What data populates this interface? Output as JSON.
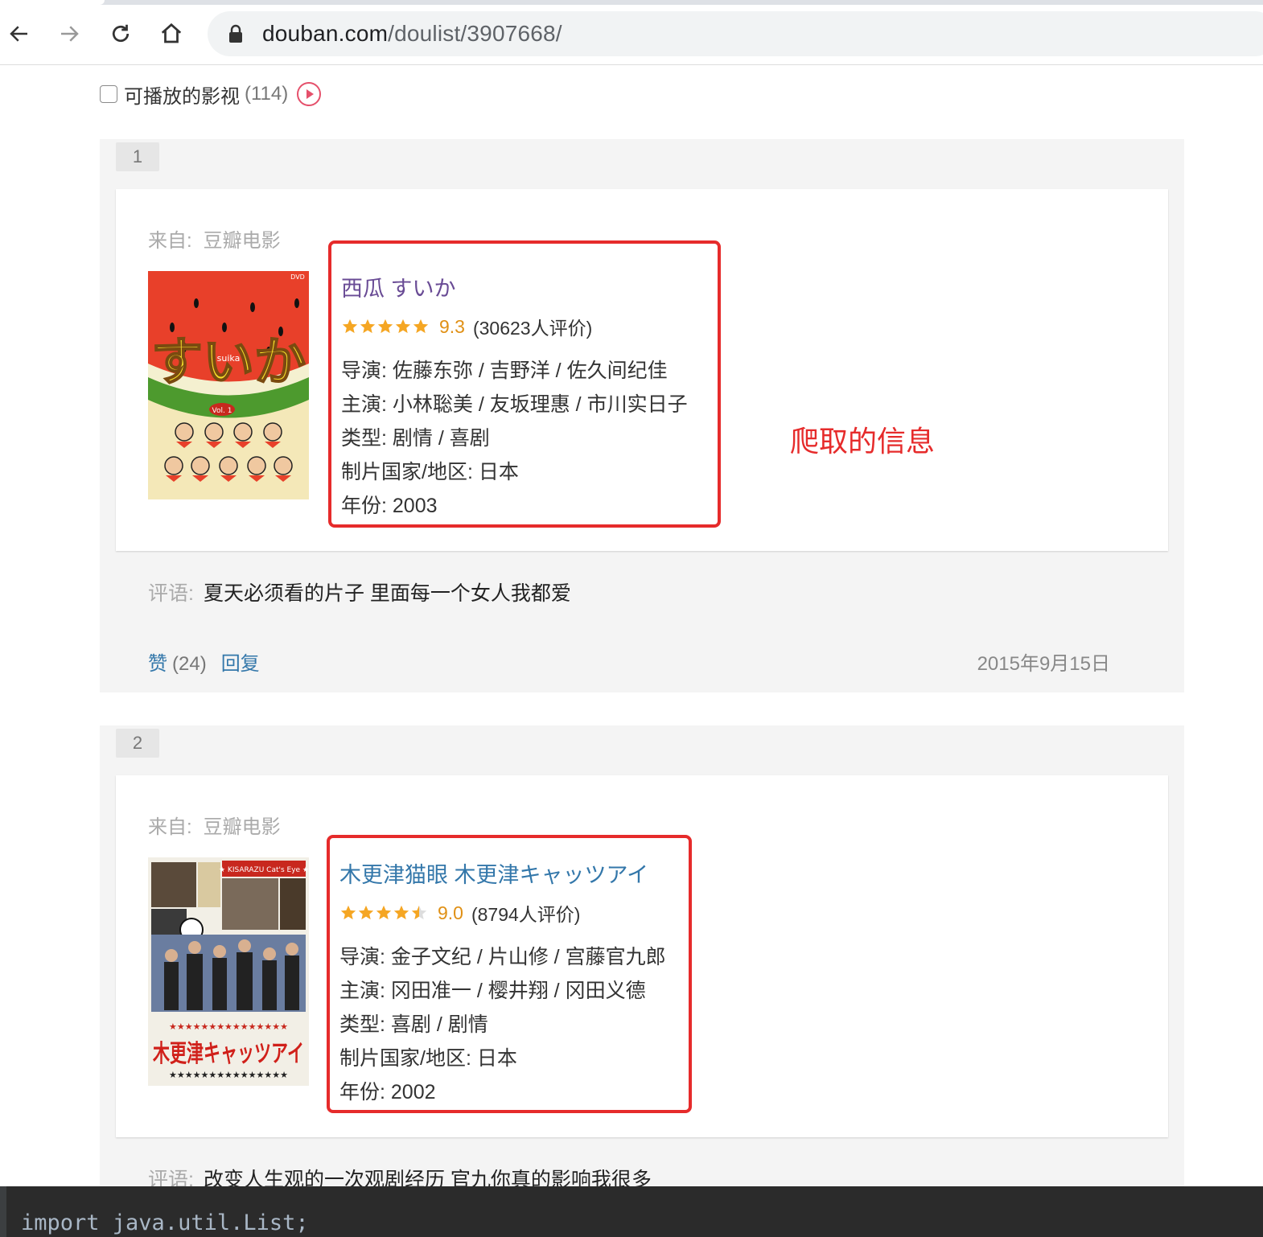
{
  "browser": {
    "url_host": "douban.com",
    "url_path": "/doulist/3907668/"
  },
  "filter": {
    "label": "可播放的影视",
    "count": "(114)"
  },
  "annotation": "爬取的信息",
  "items": [
    {
      "index": "1",
      "source_label": "来自:",
      "source": "豆瓣电影",
      "title": "西瓜 すいか",
      "stars": 5,
      "score": "9.3",
      "votes": "(30623人评价)",
      "director": "导演: 佐藤东弥 / 吉野洋 / 佐久间纪佳",
      "cast": "主演: 小林聡美 / 友坂理惠 / 市川实日子",
      "genre": "类型: 剧情 / 喜剧",
      "country": "制片国家/地区: 日本",
      "year": "年份: 2003",
      "comment_label": "评语:",
      "comment": "夏天必须看的片子 里面每一个女人我都爱",
      "like_label": "赞",
      "like_count": "(24)",
      "reply_label": "回复",
      "date": "2015年9月15日"
    },
    {
      "index": "2",
      "source_label": "来自:",
      "source": "豆瓣电影",
      "title": "木更津猫眼 木更津キャッツアイ",
      "stars": 4.5,
      "score": "9.0",
      "votes": "(8794人评价)",
      "director": "导演: 金子文纪 / 片山修 / 宫藤官九郎",
      "cast": "主演: 冈田准一 / 樱井翔 / 冈田义德",
      "genre": "类型: 喜剧 / 剧情",
      "country": "制片国家/地区: 日本",
      "year": "年份: 2002",
      "comment_label": "评语:",
      "comment": "改变人生观的一次观剧经历 官九你真的影响我很多",
      "poster2_text": "木更津キャッツアイ",
      "poster2_banner": "★ KISARAZU Cat's Eye ★"
    }
  ],
  "poster1": {
    "title_text": "すいか",
    "romaji": "suika",
    "vol": "Vol. 1",
    "badge": "DVD"
  },
  "editor": {
    "code_line": "import java.util.List;"
  },
  "colors": {
    "link": "#3377aa",
    "highlight_box": "#e62b2b",
    "star": "#f5a623",
    "score": "#e09015"
  }
}
